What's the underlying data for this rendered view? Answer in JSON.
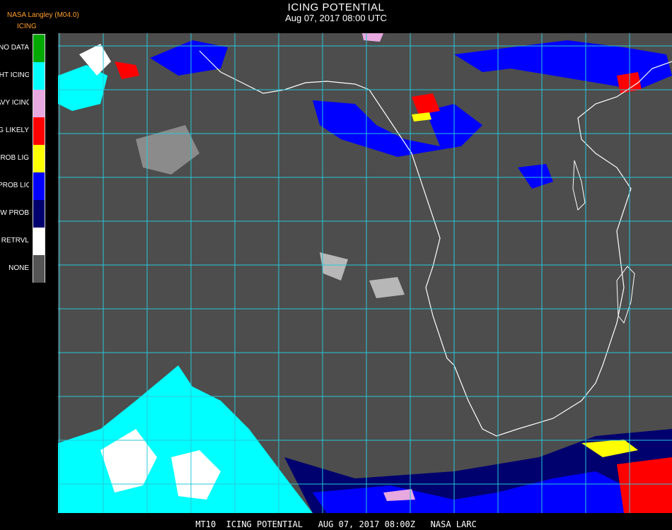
{
  "header": {
    "title": "ICING POTENTIAL",
    "subtitle": "Aug 07, 2017 08:00 UTC",
    "producer": "NASA Langley (M04.0)",
    "product": "ICING"
  },
  "legend": [
    {
      "label": "NO DATA",
      "color": "#00a800"
    },
    {
      "label": "NIGHT ICING",
      "color": "#00ffff"
    },
    {
      "label": "HEAVY ICING",
      "color": "#e8a8e0"
    },
    {
      "label": "MOG LIKELY",
      "color": "#ff0000"
    },
    {
      "label": "HI PROB LIGHT",
      "color": "#ffff00"
    },
    {
      "label": "LO PROB LIGHT",
      "color": "#0000ff"
    },
    {
      "label": "LOW PROB",
      "color": "#00006e"
    },
    {
      "label": "NO RETRVL",
      "color": "#ffffff"
    },
    {
      "label": "NONE",
      "color": "#555555"
    }
  ],
  "map": {
    "background": "#4d4d4d",
    "grid_color": "#28c8d8",
    "coast_color": "#ffffff",
    "label_color": "#d02020"
  },
  "footer": "MT10  ICING POTENTIAL   AUG 07, 2017 08:00Z   NASA LARC"
}
